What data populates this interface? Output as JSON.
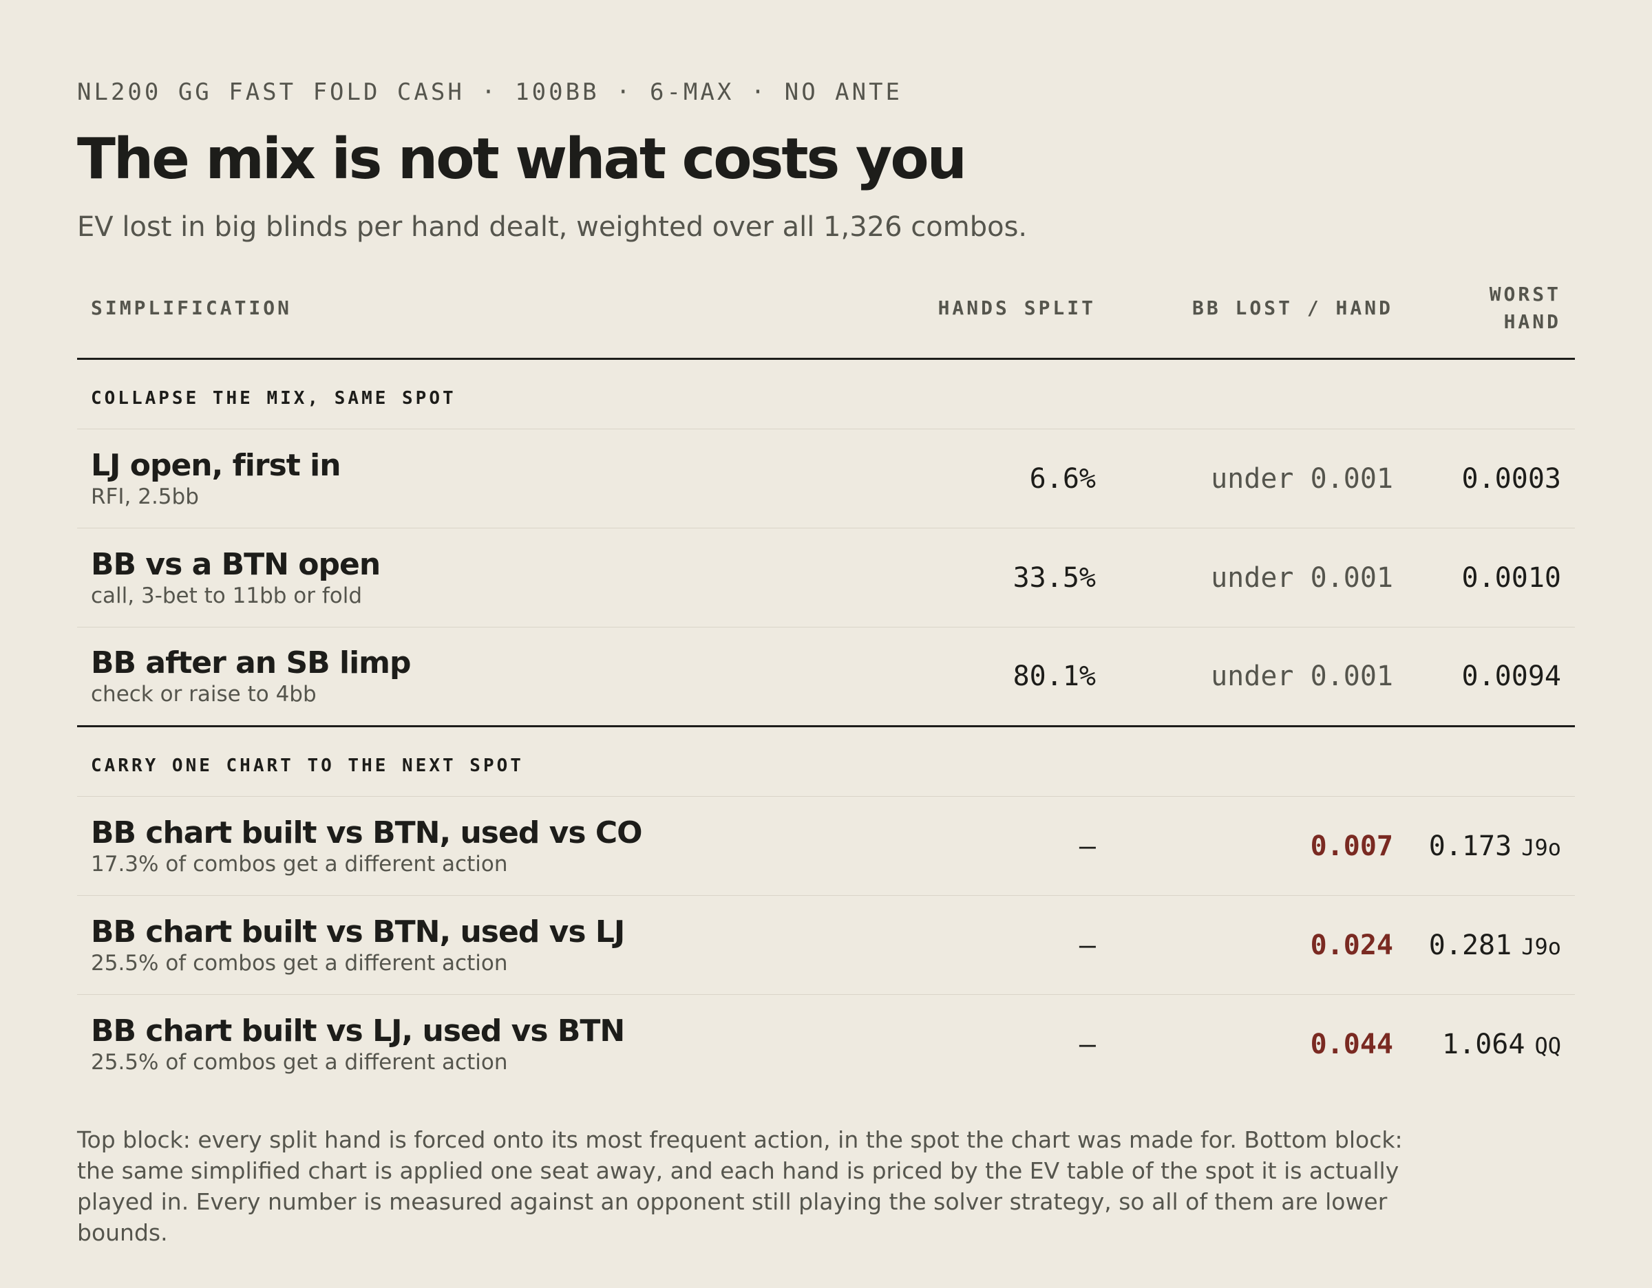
{
  "header": {
    "kicker": "NL200 GG FAST FOLD CASH · 100BB · 6-MAX · NO ANTE",
    "title": "The mix is not what costs you",
    "subtitle": "EV lost in big blinds per hand dealt, weighted over all 1,326 combos."
  },
  "table": {
    "columns": [
      "SIMPLIFICATION",
      "HANDS SPLIT",
      "BB LOST / HAND",
      "WORST HAND"
    ],
    "sections": [
      {
        "label": "COLLAPSE THE MIX, SAME SPOT",
        "rows": [
          {
            "name": "LJ open, first in",
            "detail": "RFI, 2.5bb",
            "split": "6.6%",
            "lost": "under 0.001",
            "worst": "0.0003",
            "worst_hand": ""
          },
          {
            "name": "BB vs a BTN open",
            "detail": "call, 3-bet to 11bb or fold",
            "split": "33.5%",
            "lost": "under 0.001",
            "worst": "0.0010",
            "worst_hand": ""
          },
          {
            "name": "BB after an SB limp",
            "detail": "check or raise to 4bb",
            "split": "80.1%",
            "lost": "under 0.001",
            "worst": "0.0094",
            "worst_hand": ""
          }
        ]
      },
      {
        "label": "CARRY ONE CHART TO THE NEXT SPOT",
        "rows": [
          {
            "name": "BB chart built vs BTN, used vs CO",
            "detail": "17.3% of combos get a different action",
            "split": "–",
            "lost": "0.007",
            "worst": "0.173",
            "worst_hand": "J9o"
          },
          {
            "name": "BB chart built vs BTN, used vs LJ",
            "detail": "25.5% of combos get a different action",
            "split": "–",
            "lost": "0.024",
            "worst": "0.281",
            "worst_hand": "J9o"
          },
          {
            "name": "BB chart built vs LJ, used vs BTN",
            "detail": "25.5% of combos get a different action",
            "split": "–",
            "lost": "0.044",
            "worst": "1.064",
            "worst_hand": "QQ"
          }
        ]
      }
    ]
  },
  "colors": {
    "background": "#eeeae0",
    "text": "#1d1d1a",
    "muted": "#55554d",
    "loss_red": "#7a2a22"
  },
  "footnote": "Top block: every split hand is forced onto its most frequent action, in the spot the chart was made for. Bottom block: the same simplified chart is applied one seat away, and each hand is priced by the EV table of the spot it is actually played in. Every number is measured against an opponent still playing the solver strategy, so all of them are lower bounds."
}
